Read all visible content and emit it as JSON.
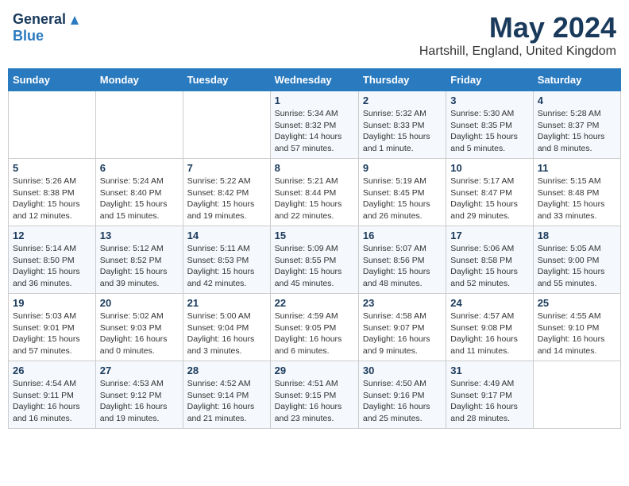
{
  "header": {
    "logo_general": "General",
    "logo_blue": "Blue",
    "month_title": "May 2024",
    "location": "Hartshill, England, United Kingdom"
  },
  "days_of_week": [
    "Sunday",
    "Monday",
    "Tuesday",
    "Wednesday",
    "Thursday",
    "Friday",
    "Saturday"
  ],
  "weeks": [
    [
      {
        "day": "",
        "info": ""
      },
      {
        "day": "",
        "info": ""
      },
      {
        "day": "",
        "info": ""
      },
      {
        "day": "1",
        "info": "Sunrise: 5:34 AM\nSunset: 8:32 PM\nDaylight: 14 hours\nand 57 minutes."
      },
      {
        "day": "2",
        "info": "Sunrise: 5:32 AM\nSunset: 8:33 PM\nDaylight: 15 hours\nand 1 minute."
      },
      {
        "day": "3",
        "info": "Sunrise: 5:30 AM\nSunset: 8:35 PM\nDaylight: 15 hours\nand 5 minutes."
      },
      {
        "day": "4",
        "info": "Sunrise: 5:28 AM\nSunset: 8:37 PM\nDaylight: 15 hours\nand 8 minutes."
      }
    ],
    [
      {
        "day": "5",
        "info": "Sunrise: 5:26 AM\nSunset: 8:38 PM\nDaylight: 15 hours\nand 12 minutes."
      },
      {
        "day": "6",
        "info": "Sunrise: 5:24 AM\nSunset: 8:40 PM\nDaylight: 15 hours\nand 15 minutes."
      },
      {
        "day": "7",
        "info": "Sunrise: 5:22 AM\nSunset: 8:42 PM\nDaylight: 15 hours\nand 19 minutes."
      },
      {
        "day": "8",
        "info": "Sunrise: 5:21 AM\nSunset: 8:44 PM\nDaylight: 15 hours\nand 22 minutes."
      },
      {
        "day": "9",
        "info": "Sunrise: 5:19 AM\nSunset: 8:45 PM\nDaylight: 15 hours\nand 26 minutes."
      },
      {
        "day": "10",
        "info": "Sunrise: 5:17 AM\nSunset: 8:47 PM\nDaylight: 15 hours\nand 29 minutes."
      },
      {
        "day": "11",
        "info": "Sunrise: 5:15 AM\nSunset: 8:48 PM\nDaylight: 15 hours\nand 33 minutes."
      }
    ],
    [
      {
        "day": "12",
        "info": "Sunrise: 5:14 AM\nSunset: 8:50 PM\nDaylight: 15 hours\nand 36 minutes."
      },
      {
        "day": "13",
        "info": "Sunrise: 5:12 AM\nSunset: 8:52 PM\nDaylight: 15 hours\nand 39 minutes."
      },
      {
        "day": "14",
        "info": "Sunrise: 5:11 AM\nSunset: 8:53 PM\nDaylight: 15 hours\nand 42 minutes."
      },
      {
        "day": "15",
        "info": "Sunrise: 5:09 AM\nSunset: 8:55 PM\nDaylight: 15 hours\nand 45 minutes."
      },
      {
        "day": "16",
        "info": "Sunrise: 5:07 AM\nSunset: 8:56 PM\nDaylight: 15 hours\nand 48 minutes."
      },
      {
        "day": "17",
        "info": "Sunrise: 5:06 AM\nSunset: 8:58 PM\nDaylight: 15 hours\nand 52 minutes."
      },
      {
        "day": "18",
        "info": "Sunrise: 5:05 AM\nSunset: 9:00 PM\nDaylight: 15 hours\nand 55 minutes."
      }
    ],
    [
      {
        "day": "19",
        "info": "Sunrise: 5:03 AM\nSunset: 9:01 PM\nDaylight: 15 hours\nand 57 minutes."
      },
      {
        "day": "20",
        "info": "Sunrise: 5:02 AM\nSunset: 9:03 PM\nDaylight: 16 hours\nand 0 minutes."
      },
      {
        "day": "21",
        "info": "Sunrise: 5:00 AM\nSunset: 9:04 PM\nDaylight: 16 hours\nand 3 minutes."
      },
      {
        "day": "22",
        "info": "Sunrise: 4:59 AM\nSunset: 9:05 PM\nDaylight: 16 hours\nand 6 minutes."
      },
      {
        "day": "23",
        "info": "Sunrise: 4:58 AM\nSunset: 9:07 PM\nDaylight: 16 hours\nand 9 minutes."
      },
      {
        "day": "24",
        "info": "Sunrise: 4:57 AM\nSunset: 9:08 PM\nDaylight: 16 hours\nand 11 minutes."
      },
      {
        "day": "25",
        "info": "Sunrise: 4:55 AM\nSunset: 9:10 PM\nDaylight: 16 hours\nand 14 minutes."
      }
    ],
    [
      {
        "day": "26",
        "info": "Sunrise: 4:54 AM\nSunset: 9:11 PM\nDaylight: 16 hours\nand 16 minutes."
      },
      {
        "day": "27",
        "info": "Sunrise: 4:53 AM\nSunset: 9:12 PM\nDaylight: 16 hours\nand 19 minutes."
      },
      {
        "day": "28",
        "info": "Sunrise: 4:52 AM\nSunset: 9:14 PM\nDaylight: 16 hours\nand 21 minutes."
      },
      {
        "day": "29",
        "info": "Sunrise: 4:51 AM\nSunset: 9:15 PM\nDaylight: 16 hours\nand 23 minutes."
      },
      {
        "day": "30",
        "info": "Sunrise: 4:50 AM\nSunset: 9:16 PM\nDaylight: 16 hours\nand 25 minutes."
      },
      {
        "day": "31",
        "info": "Sunrise: 4:49 AM\nSunset: 9:17 PM\nDaylight: 16 hours\nand 28 minutes."
      },
      {
        "day": "",
        "info": ""
      }
    ]
  ]
}
